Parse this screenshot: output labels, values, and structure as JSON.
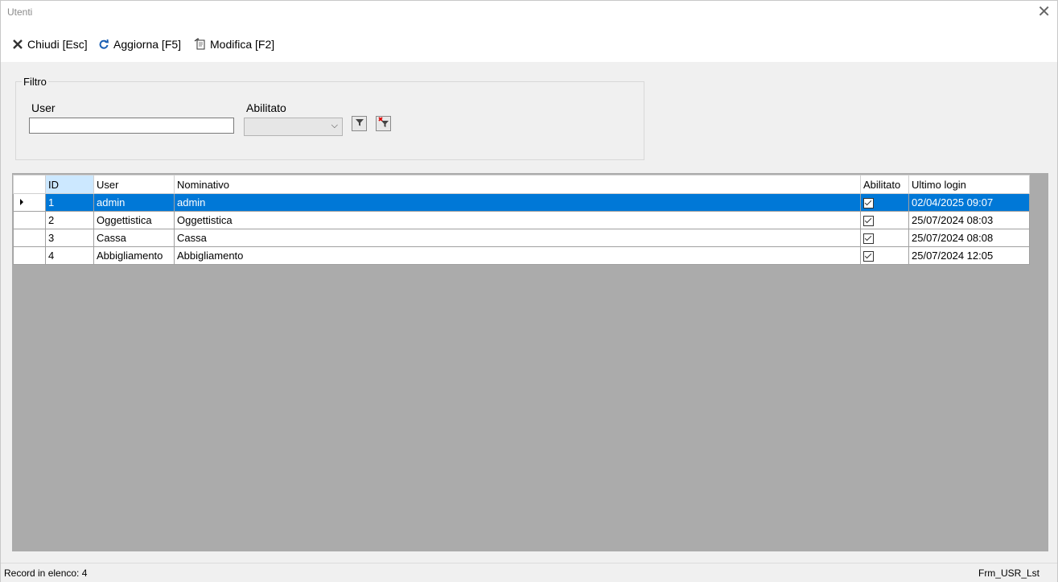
{
  "window": {
    "title": "Utenti"
  },
  "toolbar": {
    "close_label": "Chiudi [Esc]",
    "refresh_label": "Aggiorna [F5]",
    "edit_label": "Modifica [F2]"
  },
  "filter": {
    "legend": "Filtro",
    "user_label": "User",
    "user_value": "",
    "enabled_label": "Abilitato",
    "enabled_value": ""
  },
  "grid": {
    "columns": [
      "ID",
      "User",
      "Nominativo",
      "Abilitato",
      "Ultimo login"
    ],
    "rows": [
      {
        "id": "1",
        "user": "admin",
        "nominativo": "admin",
        "abilitato": true,
        "ultimo_login": "02/04/2025 09:07",
        "selected": true
      },
      {
        "id": "2",
        "user": "Oggettistica",
        "nominativo": "Oggettistica",
        "abilitato": true,
        "ultimo_login": "25/07/2024 08:03"
      },
      {
        "id": "3",
        "user": "Cassa",
        "nominativo": "Cassa",
        "abilitato": true,
        "ultimo_login": "25/07/2024 08:08"
      },
      {
        "id": "4",
        "user": "Abbigliamento",
        "nominativo": "Abbigliamento",
        "abilitato": true,
        "ultimo_login": "25/07/2024 12:05"
      }
    ]
  },
  "status": {
    "record_count": "Record in elenco: 4",
    "form_name": "Frm_USR_Lst"
  },
  "colors": {
    "selection": "#0078d7",
    "sorted_header": "#cce8ff",
    "grid_background": "#ababab"
  }
}
